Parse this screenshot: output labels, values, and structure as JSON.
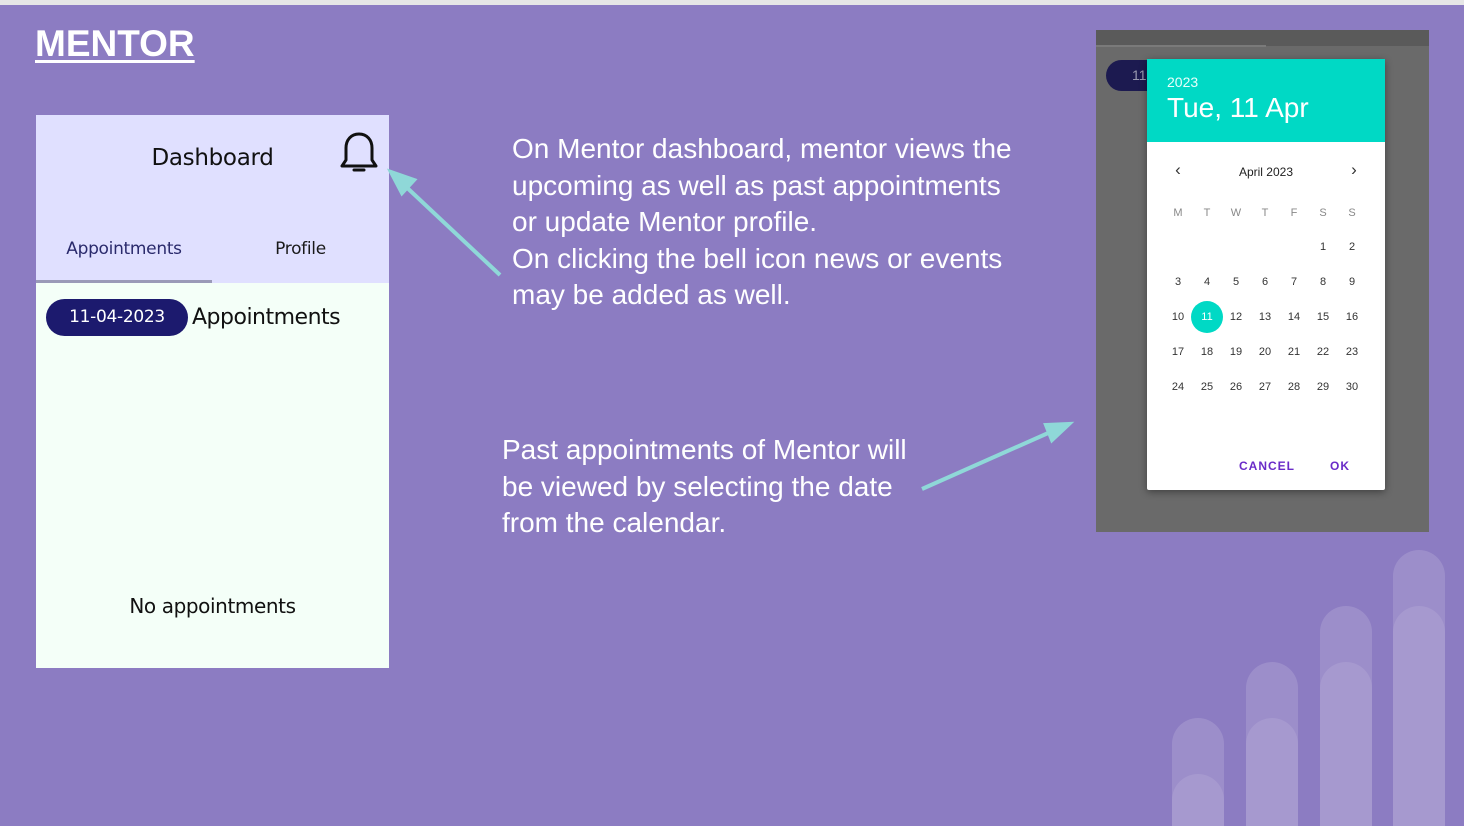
{
  "slide": {
    "title": "MENTOR"
  },
  "dashboard": {
    "title": "Dashboard",
    "tabs": [
      {
        "label": "Appointments",
        "active": true
      },
      {
        "label": "Profile",
        "active": false
      }
    ],
    "date_chip": "11-04-2023",
    "section_heading": "Appointments",
    "empty_message": "No appointments",
    "icons": {
      "notifications": "bell-icon"
    }
  },
  "descriptions": {
    "dashboard_note": "On Mentor dashboard, mentor views the upcoming as well as past appointments or update Mentor profile.\nOn clicking the bell icon news or events may be added as well.",
    "calendar_note": "Past appointments of Mentor will be viewed by selecting the date from the calendar."
  },
  "date_picker": {
    "behind_chip_text": "11",
    "year": "2023",
    "selected_date": "Tue, 11 Apr",
    "month_label": "April 2023",
    "weekdays": [
      "M",
      "T",
      "W",
      "T",
      "F",
      "S",
      "S"
    ],
    "weeks": [
      [
        "",
        "",
        "",
        "",
        "",
        "1",
        "2"
      ],
      [
        "3",
        "4",
        "5",
        "6",
        "7",
        "8",
        "9"
      ],
      [
        "10",
        "11",
        "12",
        "13",
        "14",
        "15",
        "16"
      ],
      [
        "17",
        "18",
        "19",
        "20",
        "21",
        "22",
        "23"
      ],
      [
        "24",
        "25",
        "26",
        "27",
        "28",
        "29",
        "30"
      ]
    ],
    "selected_day": "11",
    "cancel_label": "CANCEL",
    "ok_label": "OK",
    "icons": {
      "prev": "chevron-left-icon",
      "next": "chevron-right-icon"
    }
  },
  "colors": {
    "background": "#8c7cc2",
    "accent_teal": "#00d9c5",
    "navy": "#1c1a6e",
    "arrow": "#8fd8d8",
    "button_purple": "#6a2bc8"
  }
}
